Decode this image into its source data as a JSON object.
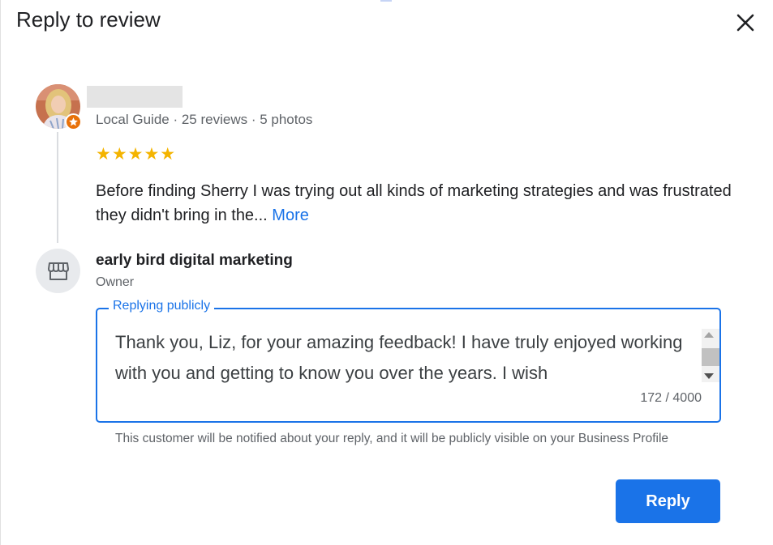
{
  "dialog": {
    "title": "Reply to review"
  },
  "review": {
    "reviewer_meta": "Local Guide · 25 reviews · 5 photos",
    "rating": 5,
    "stars": "★★★★★",
    "text": "Before finding Sherry I was trying out all kinds of marketing strategies and was frustrated they didn't bring in the... ",
    "more_label": "More"
  },
  "owner": {
    "name": "early bird digital marketing",
    "role": "Owner"
  },
  "reply": {
    "legend": "Replying publicly",
    "value": "Thank you, Liz, for your amazing feedback! I have truly enjoyed working with you and getting to know you over the years. I wish",
    "char_count": "172 / 4000",
    "notice": "This customer will be notified about your reply, and it will be publicly visible on your Business Profile",
    "button_label": "Reply"
  },
  "colors": {
    "accent": "#1a73e8",
    "star": "#f4b400",
    "local_guide_badge": "#e8710a"
  },
  "icons": [
    "close-icon",
    "local-guide-star-icon",
    "storefront-icon"
  ]
}
